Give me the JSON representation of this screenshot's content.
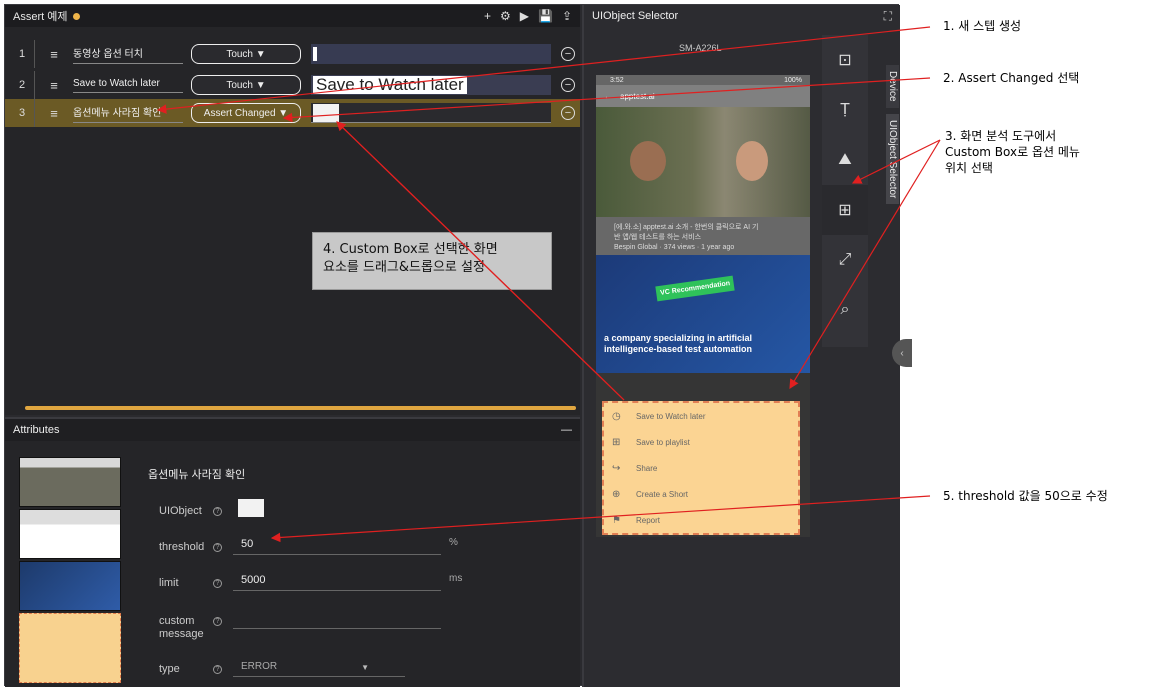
{
  "steps_panel": {
    "title": "Assert 예제",
    "tools": [
      "+",
      "⚙",
      "▶",
      "💾",
      "⇪"
    ],
    "rows": [
      {
        "num": "1",
        "title": "동영상 옵션 터치",
        "action": "Touch ▼",
        "param": ""
      },
      {
        "num": "2",
        "title": "Save to Watch later",
        "action": "Touch ▼",
        "param": "Save to Watch later"
      },
      {
        "num": "3",
        "title": "옵션메뉴 사라짐 확인",
        "action": "Assert Changed ▼",
        "param": ""
      }
    ]
  },
  "attributes": {
    "header": "Attributes",
    "collapse_label": "—",
    "step_name": "옵션메뉴 사라짐 확인",
    "labels": {
      "uiobject": "UIObject",
      "threshold": "threshold",
      "limit": "limit",
      "custom_message_1": "custom",
      "custom_message_2": "message",
      "type": "type"
    },
    "values": {
      "threshold": "50",
      "threshold_unit": "%",
      "limit": "5000",
      "limit_unit": "ms",
      "custom_message": "",
      "type": "ERROR"
    }
  },
  "selector": {
    "title": "UIObject Selector",
    "device": "SM-A226L",
    "phone": {
      "status": "3:52",
      "status_right": "100%",
      "search": "apptest.ai",
      "video1_meta_line1": "[에.와.소] apptest.ai 소개 - 한번의 클릭으로 AI 기",
      "video1_meta_line2": "반 앱/웹 테스트를 하는 서비스",
      "video1_meta_line3": "Bespin Global · 374 views · 1 year ago",
      "video2_badge": "VC Recommendation",
      "video2_text_1": "a company specializing in artificial",
      "video2_text_2": "intelligence-based test automation",
      "menu": [
        {
          "icon": "◷",
          "label": "Save to Watch later"
        },
        {
          "icon": "⊞",
          "label": "Save to playlist"
        },
        {
          "icon": "↪",
          "label": "Share"
        },
        {
          "icon": "⊕",
          "label": "Create a Short"
        },
        {
          "icon": "⚑",
          "label": "Report"
        }
      ]
    },
    "side_tabs": [
      "Device",
      "UIObject Selector"
    ]
  },
  "annotations": {
    "note1": "1. 새 스텝 생성",
    "note2": "2. Assert Changed 선택",
    "note3_line1": "3. 화면 분석 도구에서",
    "note3_line2": "Custom Box로 옵션 메뉴",
    "note3_line3": "위치 선택",
    "note4_line1": "4. Custom Box로 선택한 화면",
    "note4_line2": "요소를 드래그&드롭으로 설정",
    "note5": "5. threshold 값을 50으로 수정"
  },
  "colors": {
    "selected_row": "#6b5a25",
    "accent_scroll": "#e0a640",
    "menu_fill": "#fbd493",
    "annotation_red": "#e02020"
  }
}
